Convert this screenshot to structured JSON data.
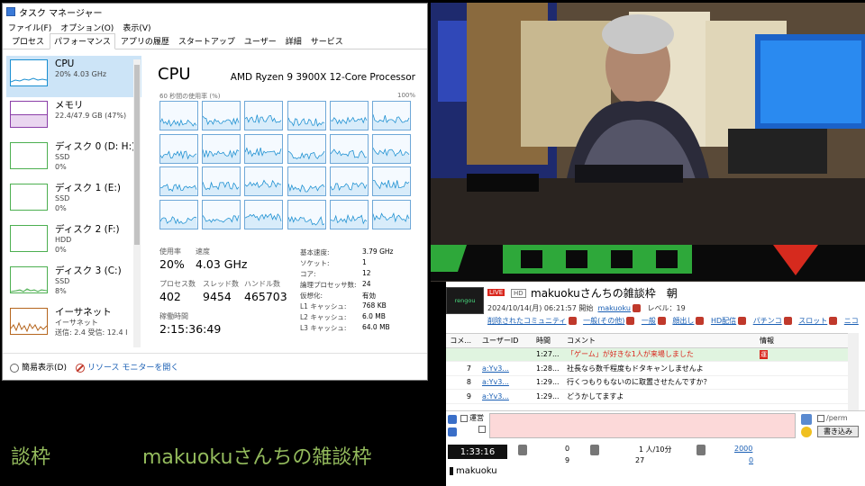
{
  "taskmgr": {
    "title": "タスク マネージャー",
    "menu": [
      "ファイル(F)",
      "オプション(O)",
      "表示(V)"
    ],
    "tabs": [
      "プロセス",
      "パフォーマンス",
      "アプリの履歴",
      "スタートアップ",
      "ユーザー",
      "詳細",
      "サービス"
    ],
    "active_tab": 1,
    "side": [
      {
        "name": "CPU",
        "l2": "20%  4.03 GHz",
        "l3": "",
        "color": "#1b8fd1"
      },
      {
        "name": "メモリ",
        "l2": "22.4/47.9 GB (47%)",
        "l3": "",
        "color": "#8b3fa8"
      },
      {
        "name": "ディスク 0 (D: H:)",
        "l2": "SSD",
        "l3": "0%",
        "color": "#4caf50"
      },
      {
        "name": "ディスク 1 (E:)",
        "l2": "SSD",
        "l3": "0%",
        "color": "#4caf50"
      },
      {
        "name": "ディスク 2 (F:)",
        "l2": "HDD",
        "l3": "0%",
        "color": "#4caf50"
      },
      {
        "name": "ディスク 3 (C:)",
        "l2": "SSD",
        "l3": "8%",
        "color": "#4caf50"
      },
      {
        "name": "イーサネット",
        "l2": "イーサネット",
        "l3": "送信: 2.4  受信: 12.4 I",
        "color": "#b5651d"
      }
    ],
    "cpu_title": "CPU",
    "cpu_model": "AMD Ryzen 9 3900X 12-Core Processor",
    "util_label": "60 秒間の使用率 (%)",
    "util_max": "100%",
    "stats": {
      "usage_label": "使用率",
      "usage": "20%",
      "speed_label": "速度",
      "speed": "4.03 GHz",
      "proc_label": "プロセス数",
      "proc": "402",
      "thread_label": "スレッド数",
      "thread": "9454",
      "handle_label": "ハンドル数",
      "handle": "465703",
      "uptime_label": "稼働時間",
      "uptime": "2:15:36:49"
    },
    "specs": [
      {
        "label": "基本速度:",
        "value": "3.79 GHz"
      },
      {
        "label": "ソケット:",
        "value": "1"
      },
      {
        "label": "コア:",
        "value": "12"
      },
      {
        "label": "論理プロセッサ数:",
        "value": "24"
      },
      {
        "label": "仮想化:",
        "value": "有効"
      },
      {
        "label": "L1 キャッシュ:",
        "value": "768 KB"
      },
      {
        "label": "L2 キャッシュ:",
        "value": "6.0 MB"
      },
      {
        "label": "L3 キャッシュ:",
        "value": "64.0 MB"
      }
    ],
    "footer_simple": "簡易表示(D)",
    "footer_monitor": "リソース モニターを開く",
    "graph_color": "#1b8fd1"
  },
  "captions": {
    "left": "談枠",
    "title": "makuokuさんちの雑談枠"
  },
  "viewer": {
    "logo_text": "rengou",
    "live": "LIVE",
    "hd": "HD",
    "title": "makuokuさんちの雑談枠　朝",
    "meta_prefix": "2024/10/14(月) 06:21:57 開始",
    "meta_user": "makuoku",
    "meta_level": "レベル：19",
    "tags": [
      "削除されたコミュニティ",
      "一般(その他)",
      "一般",
      "顔出し",
      "HD配信",
      "パチンコ",
      "スロット",
      "ニコ"
    ],
    "headers": {
      "no": "コメ...",
      "uid": "ユーザーID",
      "time": "時間",
      "comment": "コメント",
      "info": "情報"
    },
    "rows": [
      {
        "no": "",
        "uid": "",
        "time": "1:27...",
        "comment": "「ゲーム」が好きな1人が来場しました",
        "info": "運",
        "highlight": true
      },
      {
        "no": "7",
        "uid": "a:Yv3...",
        "time": "1:28...",
        "comment": "社長なら数千程度もドタキャンしませんよ",
        "info": "",
        "highlight": false
      },
      {
        "no": "8",
        "uid": "a:Yv3...",
        "time": "1:29...",
        "comment": "行くつもりもないのに取置させたんですか？",
        "info": "",
        "highlight": false
      },
      {
        "no": "9",
        "uid": "a:Yv3...",
        "time": "1:29...",
        "comment": "どうかしてますよ",
        "info": "",
        "highlight": false
      }
    ],
    "unei": "運営",
    "perm": "/perm",
    "post_button": "書き込み",
    "clock": "1:33:16",
    "status": {
      "a1": "0",
      "a2": "9",
      "b1": "1 人/10分",
      "b2": "27",
      "c1": "2000",
      "c2": "0"
    },
    "user": "makuoku"
  }
}
